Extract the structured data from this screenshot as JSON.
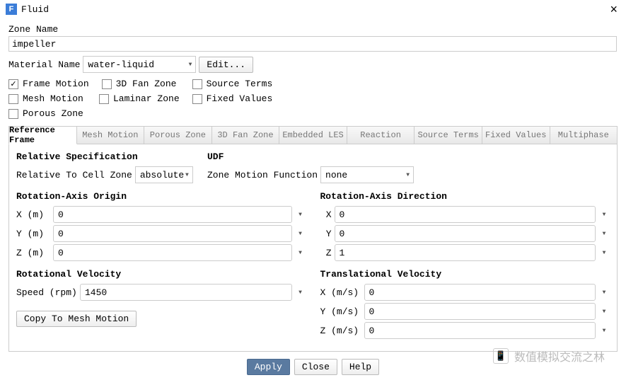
{
  "window": {
    "title": "Fluid",
    "icon_letter": "F"
  },
  "zone_name": {
    "label": "Zone Name",
    "value": "impeller"
  },
  "material": {
    "label": "Material Name",
    "value": "water-liquid",
    "edit": "Edit..."
  },
  "checkboxes": {
    "frame_motion": {
      "label": "Frame Motion",
      "checked": true
    },
    "fan_zone": {
      "label": "3D Fan Zone",
      "checked": false
    },
    "source_terms": {
      "label": "Source Terms",
      "checked": false
    },
    "mesh_motion": {
      "label": "Mesh Motion",
      "checked": false
    },
    "laminar_zone": {
      "label": "Laminar Zone",
      "checked": false
    },
    "fixed_values": {
      "label": "Fixed Values",
      "checked": false
    },
    "porous_zone": {
      "label": "Porous Zone",
      "checked": false
    }
  },
  "tabs": [
    "Reference Frame",
    "Mesh Motion",
    "Porous Zone",
    "3D Fan Zone",
    "Embedded LES",
    "Reaction",
    "Source Terms",
    "Fixed Values",
    "Multiphase"
  ],
  "rel_spec": {
    "heading": "Relative Specification",
    "label": "Relative To Cell Zone",
    "value": "absolute"
  },
  "udf": {
    "heading": "UDF",
    "label": "Zone Motion Function",
    "value": "none"
  },
  "origin": {
    "heading": "Rotation-Axis Origin",
    "x_label": "X (m)",
    "x_val": "0",
    "y_label": "Y (m)",
    "y_val": "0",
    "z_label": "Z (m)",
    "z_val": "0"
  },
  "direction": {
    "heading": "Rotation-Axis Direction",
    "x_label": "X",
    "x_val": "0",
    "y_label": "Y",
    "y_val": "0",
    "z_label": "Z",
    "z_val": "1"
  },
  "rot_vel": {
    "heading": "Rotational Velocity",
    "label": "Speed (rpm)",
    "value": "1450"
  },
  "trans_vel": {
    "heading": "Translational Velocity",
    "x_label": "X (m/s)",
    "x_val": "0",
    "y_label": "Y (m/s)",
    "y_val": "0",
    "z_label": "Z (m/s)",
    "z_val": "0"
  },
  "copy_button": "Copy To Mesh Motion",
  "buttons": {
    "apply": "Apply",
    "close": "Close",
    "help": "Help"
  },
  "watermark": "数值模拟交流之林"
}
